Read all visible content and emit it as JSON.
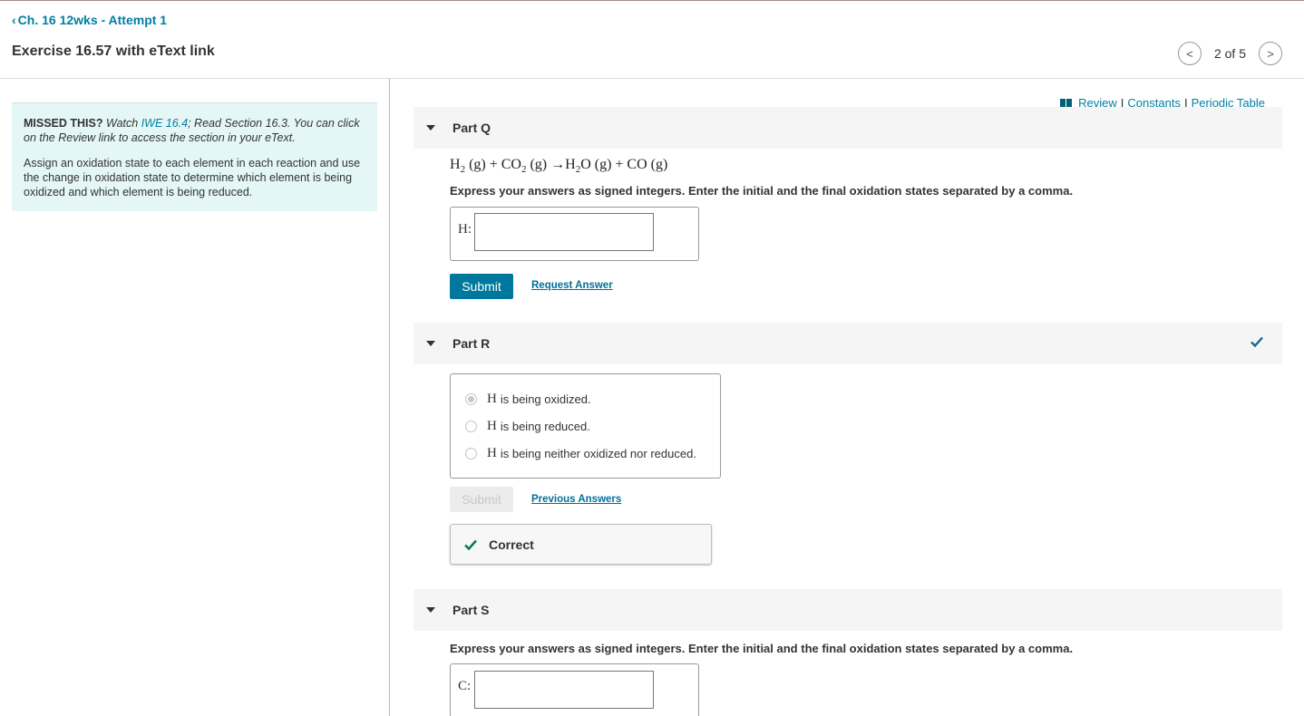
{
  "nav": {
    "back_label": "Ch. 16 12wks - Attempt 1",
    "exercise_title": "Exercise 16.57 with eText link",
    "pager_text": "2 of 5"
  },
  "hint": {
    "missed_label": "MISSED THIS?",
    "watch_text": "Watch",
    "watch_link": "IWE 16.4",
    "read_text": "; Read Section 16.3. You can click on the Review link to access the section in your eText.",
    "body": "Assign an oxidation state to each element in each reaction and use the change in oxidation state to determine which element is being oxidized and which element is being reduced."
  },
  "toplinks": {
    "review": "Review",
    "constants": "Constants",
    "periodic_table": "Periodic Table",
    "separator": "I"
  },
  "partQ": {
    "label": "Part Q",
    "eq_h": "H",
    "eq_2a": "2",
    "eq_g1": " (g) + CO",
    "eq_2b": "2",
    "eq_g2": " (g) →H",
    "eq_2c": "2",
    "eq_g3": "O (g) + CO (g)",
    "instruction": "Express your answers as signed integers. Enter the initial and the final oxidation states separated by a comma.",
    "element_label": "H:",
    "input_value": "",
    "submit": "Submit",
    "request_answer": "Request Answer"
  },
  "partR": {
    "label": "Part R",
    "options": [
      {
        "sym": "H",
        "text": "is being oxidized."
      },
      {
        "sym": "H",
        "text": "is being reduced."
      },
      {
        "sym": "H",
        "text": "is being neither oxidized nor reduced."
      }
    ],
    "selected_index": 0,
    "submit": "Submit",
    "previous_answers": "Previous Answers",
    "feedback": "Correct"
  },
  "partS": {
    "label": "Part S",
    "instruction": "Express your answers as signed integers. Enter the initial and the final oxidation states separated by a comma.",
    "element_label": "C:",
    "input_value": ""
  },
  "colors": {
    "link": "#007fa3",
    "submit_bg": "#00789e",
    "hint_bg": "#e4f6f6",
    "check": "#0a7a55"
  }
}
